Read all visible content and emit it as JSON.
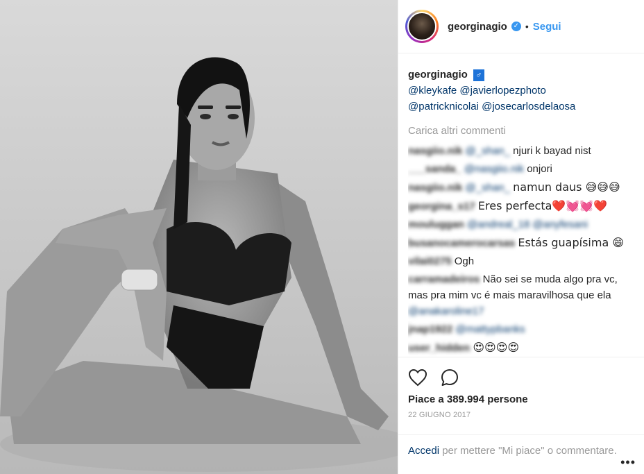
{
  "header": {
    "username": "georginagio",
    "verified_badge": "check-badge-icon",
    "separator": "•",
    "follow_label": "Segui"
  },
  "caption": {
    "username": "georginagio",
    "icon": "male-sign-icon",
    "mentions_line1": "@kleykafe @javierlopezphoto",
    "mentions_line2": "@patricknicolai @josecarlosdelaosa"
  },
  "load_more": "Carica altri commenti",
  "comments": [
    {
      "user": "nasgiio.nik",
      "mention": "@_shan_",
      "text": "njuri k bayad nist"
    },
    {
      "user": "___sanda_",
      "mention": "@nasgiio.nik",
      "text": "onjori"
    },
    {
      "user": "nasgiio.nik",
      "mention": "@_shan_",
      "text": "namun daus 😅😅😅"
    },
    {
      "user": "georgina_s17",
      "mention": "",
      "text": "Eres perfecta❤️💓💓❤️"
    },
    {
      "user": "mouluggan",
      "mention": "@andreal_18 @anyfesani",
      "text": ""
    },
    {
      "user": "busanocamerocarsas",
      "mention": "",
      "text": "Estás guapísima 😄"
    },
    {
      "user": "vilai0275",
      "mention": "",
      "text": "Ogh"
    },
    {
      "user": "carramadeiros",
      "mention": "@anakaroline17",
      "text": "Não sei se muda algo pra vc, mas pra mim vc é mais maravilhosa que ela"
    },
    {
      "user": "jnap1922",
      "mention": "@mattypbanks",
      "text": ""
    },
    {
      "user": "user_hidden",
      "mention": "",
      "text": "😍😍😍😍"
    }
  ],
  "actions": {
    "like_icon": "heart-icon",
    "comment_icon": "comment-icon",
    "likes_text": "Piace a 389.994 persone",
    "date": "22 GIUGNO 2017"
  },
  "login": {
    "link": "Accedi",
    "text": " per mettere \"Mi piace\" o commentare."
  },
  "more_label": "•••",
  "colors": {
    "link": "#003569",
    "follow": "#3897f0",
    "muted": "#999999"
  }
}
